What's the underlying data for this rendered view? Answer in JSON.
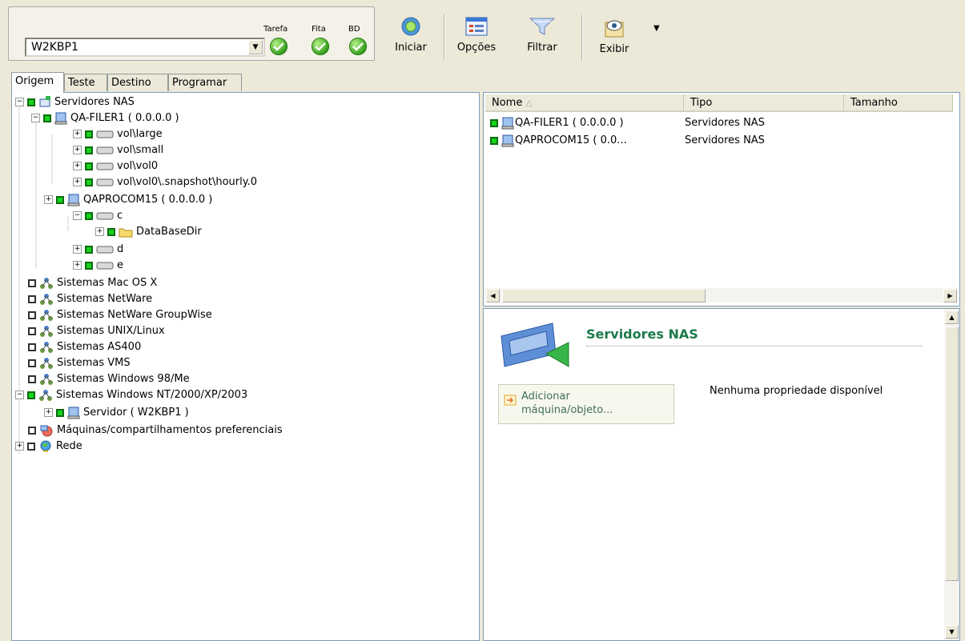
{
  "toolbar": {
    "server_value": "W2KBP1",
    "status": [
      {
        "label": "Tarefa"
      },
      {
        "label": "Fita"
      },
      {
        "label": "BD"
      }
    ],
    "buttons": {
      "start": "Iniciar",
      "options": "Opções",
      "filter": "Filtrar",
      "view": "Exibir"
    }
  },
  "tabs": [
    "Origem",
    "Teste",
    "Destino",
    "Programar"
  ],
  "tree": [
    {
      "label": "Servidores NAS"
    },
    {
      "label": "QA-FILER1 ( 0.0.0.0 )"
    },
    {
      "label": "vol\\large"
    },
    {
      "label": "vol\\small"
    },
    {
      "label": "vol\\vol0"
    },
    {
      "label": "vol\\vol0\\.snapshot\\hourly.0"
    },
    {
      "label": "QAPROCOM15 ( 0.0.0.0 )"
    },
    {
      "label": "c"
    },
    {
      "label": "DataBaseDir"
    },
    {
      "label": "d"
    },
    {
      "label": "e"
    },
    {
      "label": "Sistemas Mac OS X"
    },
    {
      "label": "Sistemas NetWare"
    },
    {
      "label": "Sistemas NetWare GroupWise"
    },
    {
      "label": "Sistemas UNIX/Linux"
    },
    {
      "label": "Sistemas AS400"
    },
    {
      "label": "Sistemas VMS"
    },
    {
      "label": "Sistemas Windows 98/Me"
    },
    {
      "label": "Sistemas Windows NT/2000/XP/2003"
    },
    {
      "label": "Servidor ( W2KBP1 )"
    },
    {
      "label": "Máquinas/compartilhamentos preferenciais"
    },
    {
      "label": "Rede"
    }
  ],
  "list": {
    "columns": {
      "name": "Nome",
      "type": "Tipo",
      "size": "Tamanho"
    },
    "rows": [
      {
        "name": "QA-FILER1 ( 0.0.0.0 )",
        "type": "Servidores NAS"
      },
      {
        "name": "QAPROCOM15 ( 0.0...",
        "type": "Servidores NAS"
      }
    ]
  },
  "details": {
    "title": "Servidores NAS",
    "add_link": "Adicionar\nmáquina/objeto...",
    "no_props": "Nenhuma propriedade disponível"
  },
  "colors": {
    "accent_green": "#1c7a4a",
    "check_green": "#16d41e",
    "panel_border": "#7f9db9",
    "bg": "#ece9d8"
  }
}
